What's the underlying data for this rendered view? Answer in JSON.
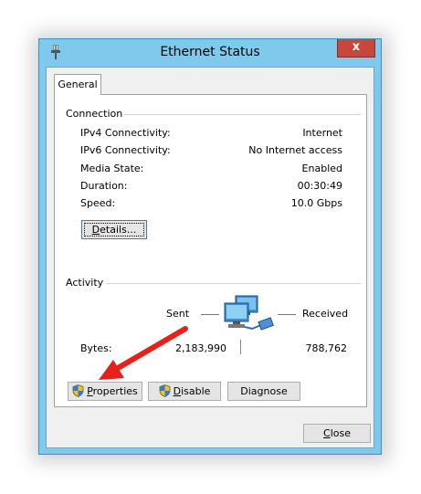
{
  "window": {
    "title": "Ethernet Status",
    "close_glyph": "x"
  },
  "tabs": [
    {
      "label": "General"
    }
  ],
  "connection": {
    "title": "Connection",
    "rows": [
      {
        "label": "IPv4 Connectivity:",
        "value": "Internet"
      },
      {
        "label": "IPv6 Connectivity:",
        "value": "No Internet access"
      },
      {
        "label": "Media State:",
        "value": "Enabled"
      },
      {
        "label": "Duration:",
        "value": "00:30:49"
      },
      {
        "label": "Speed:",
        "value": "10.0 Gbps"
      }
    ],
    "details_button": {
      "first": "D",
      "rest": "etails..."
    }
  },
  "activity": {
    "title": "Activity",
    "sent_label": "Sent",
    "received_label": "Received",
    "bytes_label": "Bytes:",
    "bytes_sent": "2,183,990",
    "bytes_received": "788,762",
    "network_icon": "network-computers-icon"
  },
  "buttons": {
    "properties": {
      "first": "P",
      "rest": "roperties"
    },
    "disable": {
      "first": "D",
      "rest": "isable"
    },
    "diagnose": {
      "label": "Diagnose"
    },
    "close": {
      "first": "C",
      "rest": "lose"
    }
  },
  "annotation": {
    "arrow_color": "#e8201a"
  },
  "colors": {
    "window_frame": "#7fc9ec",
    "close_button": "#c9463d"
  }
}
